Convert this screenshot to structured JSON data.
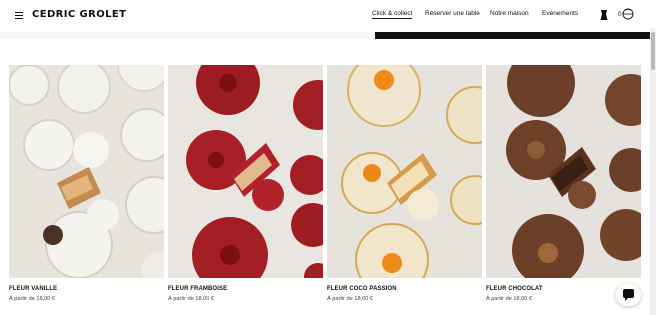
{
  "header": {
    "logo": "CEDRIC GROLET",
    "nav": [
      {
        "label": "Click & collect",
        "active": true
      },
      {
        "label": "Réserver une table",
        "active": false
      },
      {
        "label": "Notre maison",
        "active": false
      },
      {
        "label": "Evénements",
        "active": false
      }
    ],
    "cart_count": "0",
    "icons": [
      "menu-icon",
      "account-icon",
      "cart-icon"
    ]
  },
  "products": [
    {
      "name": "FLEUR VANILLE",
      "price": "À partir de 18,00 €",
      "image": "vanilla-flower-pastry"
    },
    {
      "name": "FLEUR FRAMBOISE",
      "price": "À partir de 18,00 €",
      "image": "raspberry-flower-pastry"
    },
    {
      "name": "FLEUR COCO PASSION",
      "price": "À partir de 18,00 €",
      "image": "coconut-passion-flower-pastry"
    },
    {
      "name": "FLEUR CHOCOLAT",
      "price": "À partir de 18,00 €",
      "image": "chocolate-flower-pastry"
    }
  ],
  "chat": {
    "icon": "chat-icon"
  },
  "colors": {
    "text": "#111111",
    "accent_bar": "#111111",
    "background": "#ffffff"
  }
}
